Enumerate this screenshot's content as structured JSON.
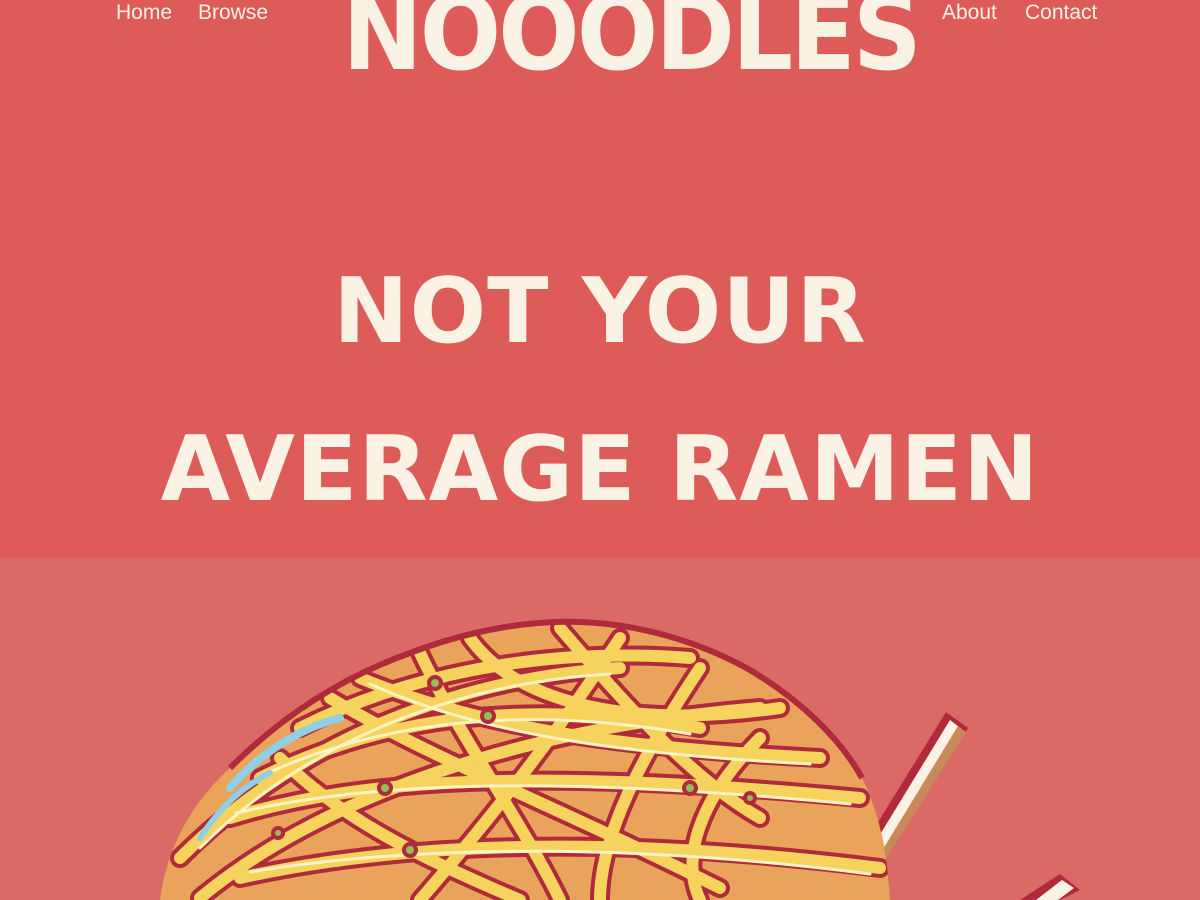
{
  "nav": {
    "left": [
      "Home",
      "Browse"
    ],
    "right": [
      "About",
      "Contact"
    ]
  },
  "brand": "NOOODLES",
  "hero": {
    "headline_line1": "NOT YOUR",
    "headline_line2": "AVERAGE RAMEN"
  },
  "colors": {
    "hero_background": "#dd5b59",
    "illustration_background": "#db6a67",
    "text": "#fbf2e6",
    "noodle": "#f5d35c",
    "outline": "#b02a3c",
    "chopstick": "#fbf2e6"
  },
  "illustration": {
    "icon": "ramen-noodles-illustration"
  }
}
